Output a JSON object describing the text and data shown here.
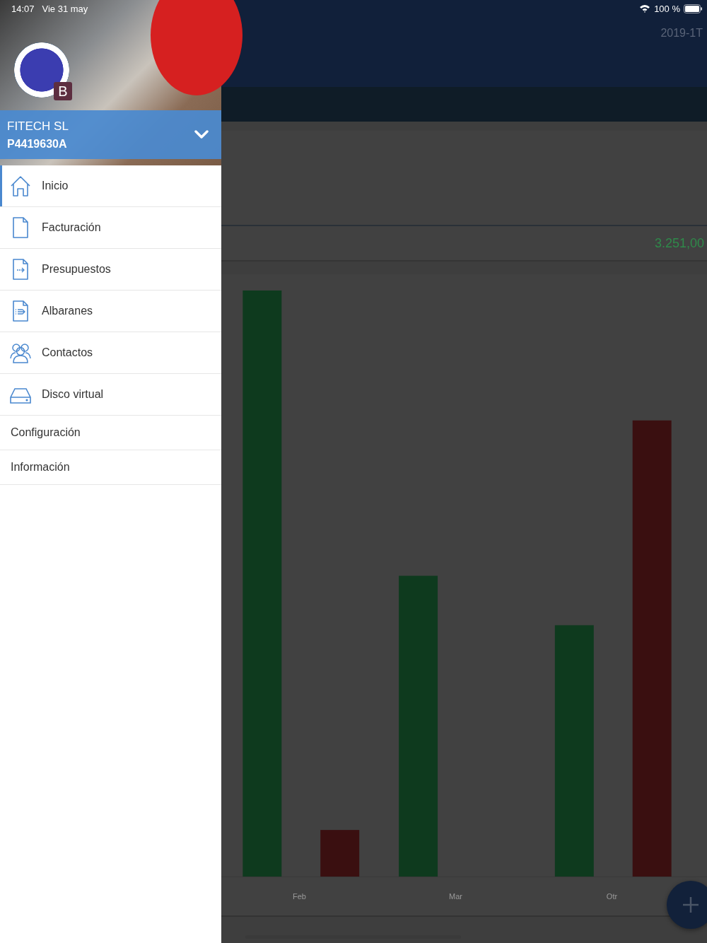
{
  "status_bar": {
    "time": "14:07",
    "date": "Vie 31 may",
    "battery": "100 %"
  },
  "account": {
    "name": "FITECH SL",
    "code": "P4419630A",
    "badge": "B"
  },
  "sidebar": {
    "items": [
      {
        "label": "Inicio",
        "kind": "icon",
        "selected": true
      },
      {
        "label": "Facturación",
        "kind": "icon",
        "selected": false
      },
      {
        "label": "Presupuestos",
        "kind": "icon",
        "selected": false
      },
      {
        "label": "Albaranes",
        "kind": "icon",
        "selected": false
      },
      {
        "label": "Contactos",
        "kind": "icon",
        "selected": false
      },
      {
        "label": "Disco virtual",
        "kind": "icon",
        "selected": false
      },
      {
        "label": "Configuración",
        "kind": "text",
        "selected": false
      },
      {
        "label": "Información",
        "kind": "text",
        "selected": false
      }
    ]
  },
  "background": {
    "period": "2019-1T",
    "total": "3.251,00",
    "chart_labels": [
      "Feb",
      "Mar",
      "Otr"
    ]
  }
}
